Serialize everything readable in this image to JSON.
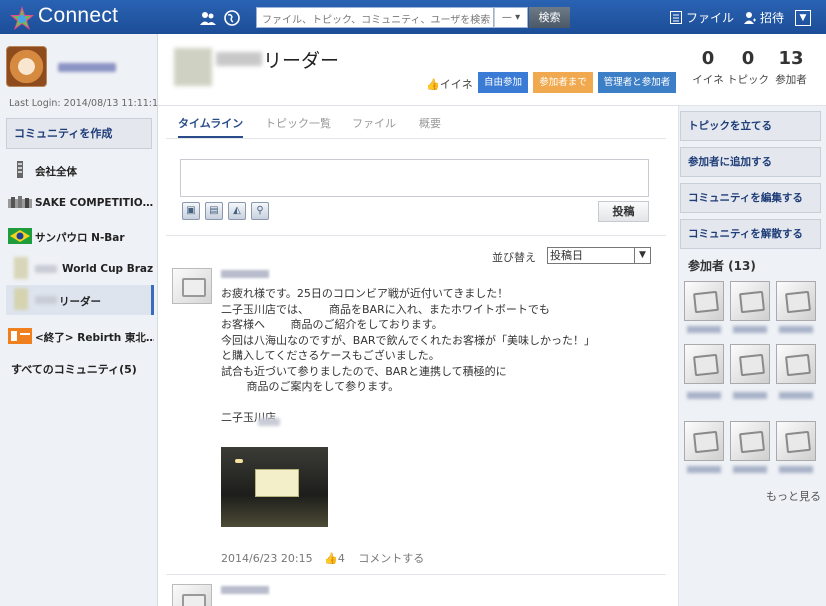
{
  "header": {
    "brand": "Connect",
    "search_placeholder": "ファイル、トピック、コミュニティ、ユーザを検索",
    "search_scope": "—",
    "search_button": "検索",
    "files_link": "ファイル",
    "invite_link": "招待",
    "menu_icon": "chevron-down-icon"
  },
  "profile": {
    "last_login": "Last Login: 2014/08/13 11:11:14"
  },
  "sidebar": {
    "create_label": "コミュニティを作成",
    "items": [
      {
        "label": "会社全体",
        "icon": "building-icon"
      },
      {
        "label": "SAKE COMPETITIO…",
        "icon": "community-thumb"
      },
      {
        "label": "サンパウロ N-Bar",
        "icon": "brazil-flag-icon"
      },
      {
        "label": "World Cup Brazil",
        "icon": "community-thumb"
      },
      {
        "label": "リーダー",
        "icon": "community-thumb"
      },
      {
        "label": "<終了> Rebirth 東北…",
        "icon": "community-thumb"
      }
    ],
    "all_label": "すべてのコミュニティ(5)"
  },
  "community": {
    "title": "リーダー",
    "iine": "イイネ",
    "badges": [
      "自由参加",
      "参加者まで",
      "管理者と参加者"
    ],
    "stats": [
      {
        "value": "0",
        "label": "イイネ"
      },
      {
        "value": "0",
        "label": "トピック"
      },
      {
        "value": "13",
        "label": "参加者"
      }
    ]
  },
  "tabs": [
    "タイムライン",
    "トピック一覧",
    "ファイル",
    "概要"
  ],
  "composer": {
    "post_button": "投稿"
  },
  "sort": {
    "label": "並び替え",
    "value": "投稿日"
  },
  "post": {
    "body": "お疲れ様です。25日のコロンビア戦が近付いてきました！\n二子玉川店では、　　 商品をBARに入れ、またホワイトボートでも\nお客様へ　　 商品のご紹介をしております。\n今回は八海山なのですが、BARで飲んでくれたお客様が「美味しかった！」\nと購入してくださるケースもございました。\n試合も近づいて参りましたので、BARと連携して積極的に\n　　 商品のご案内をして参ります。\n\n二子玉川店",
    "date": "2014/6/23 20:15",
    "likes": "4",
    "comment_link": "コメントする"
  },
  "actions": [
    "トピックを立てる",
    "参加者に追加する",
    "コミュニティを編集する",
    "コミュニティを解散する"
  ],
  "members": {
    "title": "参加者 (13)",
    "more": "もっと見る"
  },
  "colors": {
    "topbar": "#1c4d97",
    "badge_blue": "#3a7bd5",
    "badge_orange": "#f0a94e",
    "badge_blue2": "#3d7fc6"
  }
}
